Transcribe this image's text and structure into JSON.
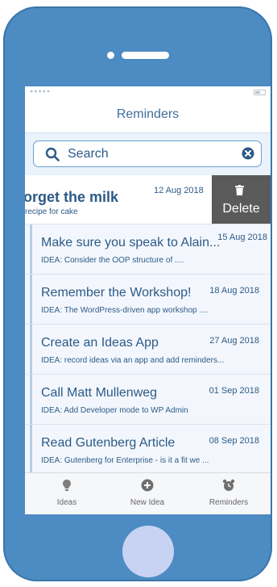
{
  "app": {
    "title": "Reminders"
  },
  "search": {
    "placeholder": "Search"
  },
  "swiped_item": {
    "title": "orget the milk",
    "date": "12 Aug 2018",
    "subtitle": "recipe for cake",
    "action_label": "Delete"
  },
  "reminders": [
    {
      "title": "Make sure you speak to Alain...",
      "date": "15 Aug 2018",
      "subtitle": "IDEA: Consider the OOP structure of ...."
    },
    {
      "title": "Remember the Workshop!",
      "date": "18 Aug 2018",
      "subtitle": "IDEA: The WordPress-driven app workshop ...."
    },
    {
      "title": "Create an Ideas App",
      "date": "27 Aug 2018",
      "subtitle": "IDEA: record ideas via an app and add reminders..."
    },
    {
      "title": "Call Matt Mullenweg",
      "date": "01 Sep 2018",
      "subtitle": "IDEA: Add Developer mode to WP Admin"
    },
    {
      "title": "Read Gutenberg Article",
      "date": "08 Sep 2018",
      "subtitle": "IDEA: Gutenberg for Enterprise - is it a fit we ..."
    }
  ],
  "tabs": [
    {
      "label": "Ideas",
      "icon": "lightbulb-icon"
    },
    {
      "label": "New Idea",
      "icon": "plus-circle-icon"
    },
    {
      "label": "Reminders",
      "icon": "alarm-clock-icon"
    }
  ],
  "colors": {
    "phone": "#4d8bc3",
    "accent": "#2c5a86",
    "delete_bg": "#5a5a5a",
    "home_button": "#c8d3f4"
  }
}
